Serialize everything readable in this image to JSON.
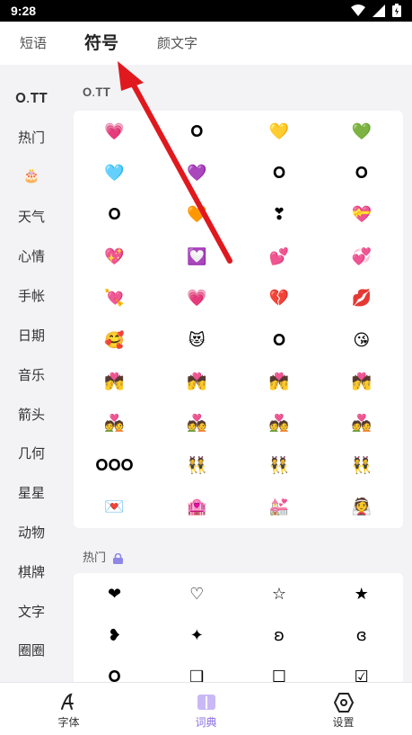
{
  "status": {
    "time": "9:28"
  },
  "tabs": [
    {
      "label": "短语"
    },
    {
      "label": "符号"
    },
    {
      "label": "颜文字"
    }
  ],
  "sidebar": {
    "items": [
      {
        "label": "𝐎.𝐓𝐓"
      },
      {
        "label": "热门"
      },
      {
        "label": "🎂"
      },
      {
        "label": "天气"
      },
      {
        "label": "心情"
      },
      {
        "label": "手帐"
      },
      {
        "label": "日期"
      },
      {
        "label": "音乐"
      },
      {
        "label": "箭头"
      },
      {
        "label": "几何"
      },
      {
        "label": "星星"
      },
      {
        "label": "动物"
      },
      {
        "label": "棋牌"
      },
      {
        "label": "文字"
      },
      {
        "label": "圈圈"
      }
    ]
  },
  "sections": [
    {
      "title": "𝐎.𝐓𝐓",
      "symbols": [
        "💗",
        "𝐎",
        "💛",
        "💚",
        "🩵",
        "💜",
        "𝐎",
        "𝐎",
        "𝐎",
        "🧡",
        "❣",
        "💝",
        "💖",
        "💟",
        "💕",
        "💞",
        "💘",
        "💗",
        "💔",
        "💋",
        "🥰",
        "😻",
        "𝐎",
        "😘",
        "💏",
        "💏",
        "💏",
        "💏",
        "💑",
        "💑",
        "💑",
        "💑",
        "𝐎𝐎𝐎",
        "👯",
        "👯",
        "👯",
        "💌",
        "🏩",
        "💒",
        "👰"
      ]
    },
    {
      "title": "热门",
      "locked": true,
      "symbols": [
        "❤",
        "♡",
        "☆",
        "★",
        "❥",
        "✦",
        "ʚ",
        "ɞ",
        "𝐎",
        "❑",
        "☐",
        "☑"
      ]
    }
  ],
  "bottom_nav": [
    {
      "label": "字体",
      "icon": "font-icon"
    },
    {
      "label": "词典",
      "icon": "book-icon",
      "active": true
    },
    {
      "label": "设置",
      "icon": "settings-icon"
    }
  ],
  "colors": {
    "accent": "#8a6fe0",
    "arrow": "#e0191e"
  }
}
